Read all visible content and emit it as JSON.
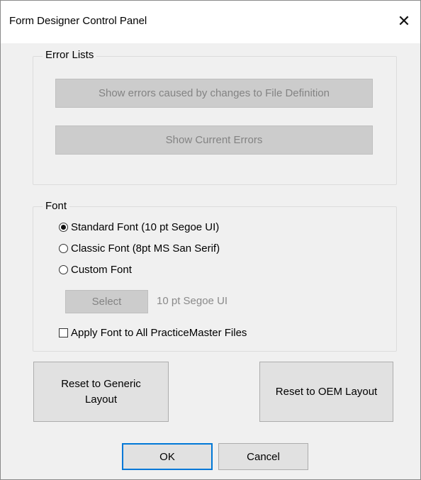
{
  "window": {
    "title": "Form Designer Control Panel",
    "close_icon": "close-icon",
    "close_glyph": "✕"
  },
  "error_lists": {
    "label": "Error Lists",
    "show_file_def_errors": "Show errors caused by changes to File Definition",
    "show_current_errors": "Show Current Errors"
  },
  "font": {
    "label": "Font",
    "options": [
      {
        "label": "Standard Font (10 pt Segoe UI)",
        "checked": true
      },
      {
        "label": "Classic Font (8pt MS San Serif)",
        "checked": false
      },
      {
        "label": "Custom Font",
        "checked": false
      }
    ],
    "select_button": "Select",
    "current_font": "10 pt Segoe UI",
    "apply_all_label": "Apply Font to All PracticeMaster Files",
    "apply_all_checked": false
  },
  "reset": {
    "generic_line1": "Reset to Generic",
    "generic_line2": "Layout",
    "oem": "Reset to OEM Layout"
  },
  "footer": {
    "ok": "OK",
    "cancel": "Cancel"
  },
  "colors": {
    "accent": "#0078d7",
    "disabled_bg": "#cccccc",
    "window_bg": "#f0f0f0"
  }
}
